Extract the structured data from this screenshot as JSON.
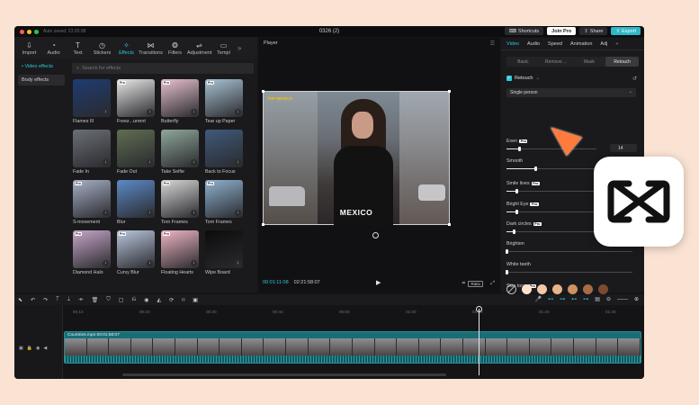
{
  "window": {
    "autosave": "Auto saved: 23:20:08",
    "title": "0326 (2)",
    "shortcuts": "Shortcuts",
    "join_pro": "Join Pro",
    "share": "Share",
    "export": "Export",
    "traffic_colors": [
      "#ff5f57",
      "#febc2e",
      "#28c840"
    ]
  },
  "toolbar": {
    "items": [
      {
        "label": "Import",
        "icon": "import-icon"
      },
      {
        "label": "Audio",
        "icon": "audio-icon"
      },
      {
        "label": "Text",
        "icon": "text-icon"
      },
      {
        "label": "Stickers",
        "icon": "stickers-icon"
      },
      {
        "label": "Effects",
        "icon": "effects-icon",
        "active": true
      },
      {
        "label": "Transitions",
        "icon": "transitions-icon"
      },
      {
        "label": "Filters",
        "icon": "filters-icon"
      },
      {
        "label": "Adjustment",
        "icon": "adjustment-icon"
      },
      {
        "label": "Templ",
        "icon": "templates-icon"
      }
    ]
  },
  "categories": {
    "video_effects": "• Video effects",
    "body_effects": "Body effects"
  },
  "effects": {
    "search_placeholder": "Search for effects",
    "items": [
      {
        "label": "Flames III",
        "bg": "#1f3c72",
        "pro": false
      },
      {
        "label": "Freez...urrent",
        "bg": "#e8e8e8",
        "pro": true
      },
      {
        "label": "Butterfly",
        "bg": "#e7c1ce",
        "pro": true
      },
      {
        "label": "Tear up Paper",
        "bg": "#a9c2d4",
        "pro": true
      },
      {
        "label": "Fade In",
        "bg": "#6b6f76",
        "pro": false
      },
      {
        "label": "Fade Out",
        "bg": "#5f6e52",
        "pro": false
      },
      {
        "label": "Take Selfie",
        "bg": "#8fa89a",
        "pro": false
      },
      {
        "label": "Back to Focus",
        "bg": "#3f5a7a",
        "pro": false
      },
      {
        "label": "S-movement",
        "bg": "#a6b0c6",
        "pro": true
      },
      {
        "label": "Blur",
        "bg": "#5c8ac7",
        "pro": false
      },
      {
        "label": "Torn Frames",
        "bg": "#d8d8d8",
        "pro": true
      },
      {
        "label": "Torn Frames",
        "bg": "#8fb2cf",
        "pro": true
      },
      {
        "label": "Diamond Halo",
        "bg": "#c7a6c9",
        "pro": true
      },
      {
        "label": "Curvy Blur",
        "bg": "#b9c7de",
        "pro": true
      },
      {
        "label": "Floating Hearts",
        "bg": "#f0b6c4",
        "pro": true
      },
      {
        "label": "Wipe Board",
        "bg": "#0c0c0c",
        "pro": false
      }
    ]
  },
  "player": {
    "header": "Player",
    "caption": "MEXICO",
    "overlay_logo": "TOP MEXICO",
    "current_time": "00:01:11:08",
    "total_time": "02:21:58:07",
    "ratio": "Ratio"
  },
  "properties": {
    "tabs": [
      "Video",
      "Audio",
      "Speed",
      "Animation",
      "Adj"
    ],
    "subtabs": [
      "Basic",
      "Remove ...",
      "Mask",
      "Retouch"
    ],
    "retouch_label": "Retouch",
    "person_select": "Single person",
    "sliders": [
      {
        "label": "Even",
        "pro": true,
        "value": 0.14,
        "display": "14",
        "numbox": true
      },
      {
        "label": "Smooth",
        "pro": false,
        "value": 0.32,
        "display": "32",
        "numbox": true
      },
      {
        "label": "Smile lines",
        "pro": true,
        "value": 0.08
      },
      {
        "label": "Bright Eye",
        "pro": true,
        "value": 0.08
      },
      {
        "label": "Dark circles",
        "pro": true,
        "value": 0.06
      },
      {
        "label": "Brighten",
        "pro": false,
        "value": 0.0
      },
      {
        "label": "White teeth",
        "pro": false,
        "value": 0.0
      },
      {
        "label": "Skin tone",
        "pro": true,
        "value": null
      }
    ],
    "skin_tones": [
      "#fde2cf",
      "#f3c9a8",
      "#e8b28a",
      "#cf915f",
      "#a86b44",
      "#7c4b2f"
    ]
  },
  "timeline": {
    "ticks": [
      "00:10",
      "00:20",
      "00:30",
      "00:40",
      "00:50",
      "01:00",
      "01:10",
      "01:20",
      "01:30"
    ],
    "clip_name": "Countries.mp4",
    "clip_duration": "00:01:58:07"
  },
  "colors": {
    "accent": "#2fc8d8",
    "background": "#fbe3d3",
    "cursor": "#ff7a3d"
  }
}
